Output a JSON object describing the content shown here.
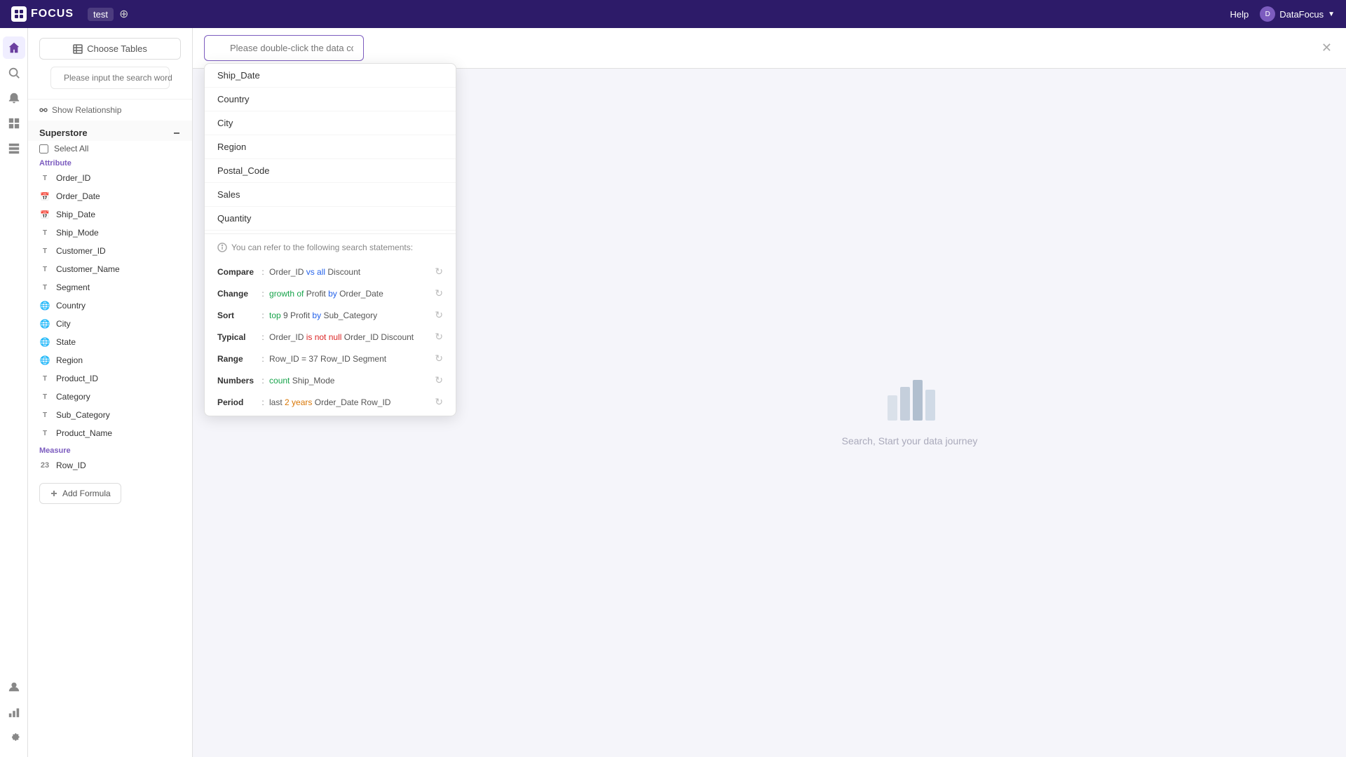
{
  "app": {
    "name": "FOCUS",
    "tab": "test",
    "help_label": "Help",
    "user_label": "DataFocus",
    "nav_icon": "▣"
  },
  "left_sidebar": {
    "icons": [
      {
        "name": "home-icon",
        "symbol": "⌂"
      },
      {
        "name": "search-icon",
        "symbol": "⌕"
      },
      {
        "name": "alert-icon",
        "symbol": "🔔"
      },
      {
        "name": "layout-icon",
        "symbol": "▦"
      },
      {
        "name": "grid-icon",
        "symbol": "⊞"
      },
      {
        "name": "user-icon",
        "symbol": "👤"
      },
      {
        "name": "chart-icon",
        "symbol": "📊"
      },
      {
        "name": "settings-icon",
        "symbol": "⚙"
      }
    ]
  },
  "left_panel": {
    "choose_tables_label": "Choose Tables",
    "search_placeholder": "Please input the search words",
    "show_relationship_label": "Show Relationship",
    "superstore_label": "Superstore",
    "select_all_label": "Select All",
    "attribute_label": "Attribute",
    "measure_label": "Measure",
    "fields": [
      {
        "name": "Order_ID",
        "type": "T"
      },
      {
        "name": "Order_Date",
        "type": "date"
      },
      {
        "name": "Ship_Date",
        "type": "date"
      },
      {
        "name": "Ship_Mode",
        "type": "T"
      },
      {
        "name": "Customer_ID",
        "type": "T"
      },
      {
        "name": "Customer_Name",
        "type": "T"
      },
      {
        "name": "Segment",
        "type": "T"
      },
      {
        "name": "Country",
        "type": "globe"
      },
      {
        "name": "City",
        "type": "globe"
      },
      {
        "name": "State",
        "type": "globe"
      },
      {
        "name": "Region",
        "type": "globe"
      },
      {
        "name": "Product_ID",
        "type": "T"
      },
      {
        "name": "Category",
        "type": "T"
      },
      {
        "name": "Sub_Category",
        "type": "T"
      },
      {
        "name": "Product_Name",
        "type": "T"
      }
    ],
    "measure_fields": [
      {
        "name": "Row_ID",
        "type": "hash"
      }
    ],
    "add_formula_label": "Add Formula"
  },
  "search_bar": {
    "placeholder": "Please double-click the data column on the left, or enter a keyword statement"
  },
  "dropdown": {
    "columns": [
      {
        "label": "Ship_Date"
      },
      {
        "label": "Country"
      },
      {
        "label": "City"
      },
      {
        "label": "Region"
      },
      {
        "label": "Postal_Code"
      },
      {
        "label": "Sales"
      },
      {
        "label": "Quantity"
      }
    ],
    "hint": "You can refer to the following search statements:",
    "keywords": [
      {
        "label": "Compare",
        "colon": ":",
        "parts": [
          {
            "text": "Order_ID ",
            "style": "normal"
          },
          {
            "text": "vs all",
            "style": "blue"
          },
          {
            "text": " Discount",
            "style": "normal"
          }
        ]
      },
      {
        "label": "Change",
        "colon": ":",
        "parts": [
          {
            "text": "growth of",
            "style": "green"
          },
          {
            "text": " Profit ",
            "style": "normal"
          },
          {
            "text": "by",
            "style": "blue"
          },
          {
            "text": " Order_Date",
            "style": "normal"
          }
        ]
      },
      {
        "label": "Sort",
        "colon": ":",
        "parts": [
          {
            "text": "top",
            "style": "green"
          },
          {
            "text": " 9 Profit ",
            "style": "normal"
          },
          {
            "text": "by",
            "style": "blue"
          },
          {
            "text": " Sub_Category",
            "style": "normal"
          }
        ]
      },
      {
        "label": "Typical",
        "colon": ":",
        "parts": [
          {
            "text": "Order_ID ",
            "style": "normal"
          },
          {
            "text": "is not null",
            "style": "red"
          },
          {
            "text": " Order_ID Discount",
            "style": "normal"
          }
        ]
      },
      {
        "label": "Range",
        "colon": ":",
        "parts": [
          {
            "text": "Row_ID = 37 Row_ID Segment",
            "style": "normal"
          }
        ]
      },
      {
        "label": "Numbers",
        "colon": ":",
        "parts": [
          {
            "text": "count",
            "style": "green"
          },
          {
            "text": " Ship_Mode",
            "style": "normal"
          }
        ]
      },
      {
        "label": "Period",
        "colon": ":",
        "parts": [
          {
            "text": "last ",
            "style": "normal"
          },
          {
            "text": "2 years",
            "style": "orange"
          },
          {
            "text": " Order_Date Row_ID",
            "style": "normal"
          }
        ]
      }
    ]
  },
  "empty_state": {
    "text": "Search, Start your data journey"
  }
}
